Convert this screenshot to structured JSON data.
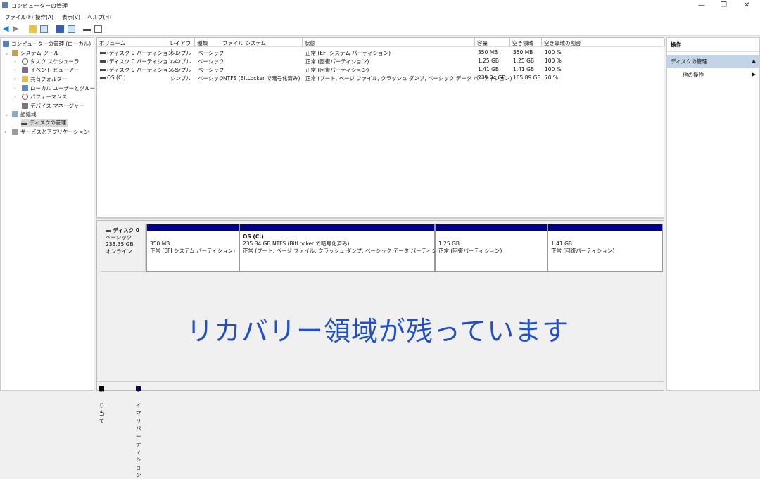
{
  "window": {
    "title": "コンピューターの管理",
    "minimize": "—",
    "maximize": "❐",
    "close": "✕"
  },
  "menu": [
    "ファイル(F)",
    "操作(A)",
    "表示(V)",
    "ヘルプ(H)"
  ],
  "tree": {
    "root": "コンピューターの管理 (ローカル)",
    "system_tools": "システム ツール",
    "task_scheduler": "タスク スケジューラ",
    "event_viewer": "イベント ビューアー",
    "shared_folders": "共有フォルダー",
    "local_users": "ローカル ユーザーとグループ",
    "performance": "パフォーマンス",
    "device_manager": "デバイス マネージャー",
    "storage": "記憶域",
    "disk_management": "ディスクの管理",
    "services": "サービスとアプリケーション"
  },
  "volumes": {
    "headers": [
      "ボリューム",
      "レイアウト",
      "種類",
      "ファイル システム",
      "状態",
      "容量",
      "空き領域",
      "空き領域の割合"
    ],
    "rows": [
      [
        "(ディスク 0 パーティション 1)",
        "シンプル",
        "ベーシック",
        "",
        "正常 (EFI システム パーティション)",
        "350 MB",
        "350 MB",
        "100 %"
      ],
      [
        "(ディスク 0 パーティション 4)",
        "シンプル",
        "ベーシック",
        "",
        "正常 (回復パーティション)",
        "1.25 GB",
        "1.25 GB",
        "100 %"
      ],
      [
        "(ディスク 0 パーティション 5)",
        "シンプル",
        "ベーシック",
        "",
        "正常 (回復パーティション)",
        "1.41 GB",
        "1.41 GB",
        "100 %"
      ],
      [
        "OS (C:)",
        "シンプル",
        "ベーシック",
        "NTFS (BitLocker で暗号化済み)",
        "正常 (ブート, ページ ファイル, クラッシュ ダンプ, ベーシック データ パーティション)",
        "235.34 GB",
        "165.89 GB",
        "70 %"
      ]
    ]
  },
  "disk": {
    "name": "ディスク 0",
    "type": "ベーシック",
    "size": "238.35 GB",
    "status": "オンライン",
    "partitions": [
      {
        "title": "",
        "line1": "350 MB",
        "line2": "正常 (EFI システム パーティション)"
      },
      {
        "title": "OS  (C:)",
        "line1": "235.34 GB NTFS (BitLocker で暗号化済み)",
        "line2": "正常 (ブート, ページ ファイル, クラッシュ ダンプ, ベーシック データ パーティション)"
      },
      {
        "title": "",
        "line1": "1.25 GB",
        "line2": "正常 (回復パーティション)"
      },
      {
        "title": "",
        "line1": "1.41 GB",
        "line2": "正常 (回復パーティション)"
      }
    ]
  },
  "overlay_text": "リカバリー領域が残っています",
  "legend": {
    "unallocated": "未割り当て",
    "primary": "プライマリ パーティション",
    "unallocated_color": "#000000",
    "primary_color": "#00008b"
  },
  "actions": {
    "title": "操作",
    "section": "ディスクの管理",
    "more": "他の操作"
  }
}
